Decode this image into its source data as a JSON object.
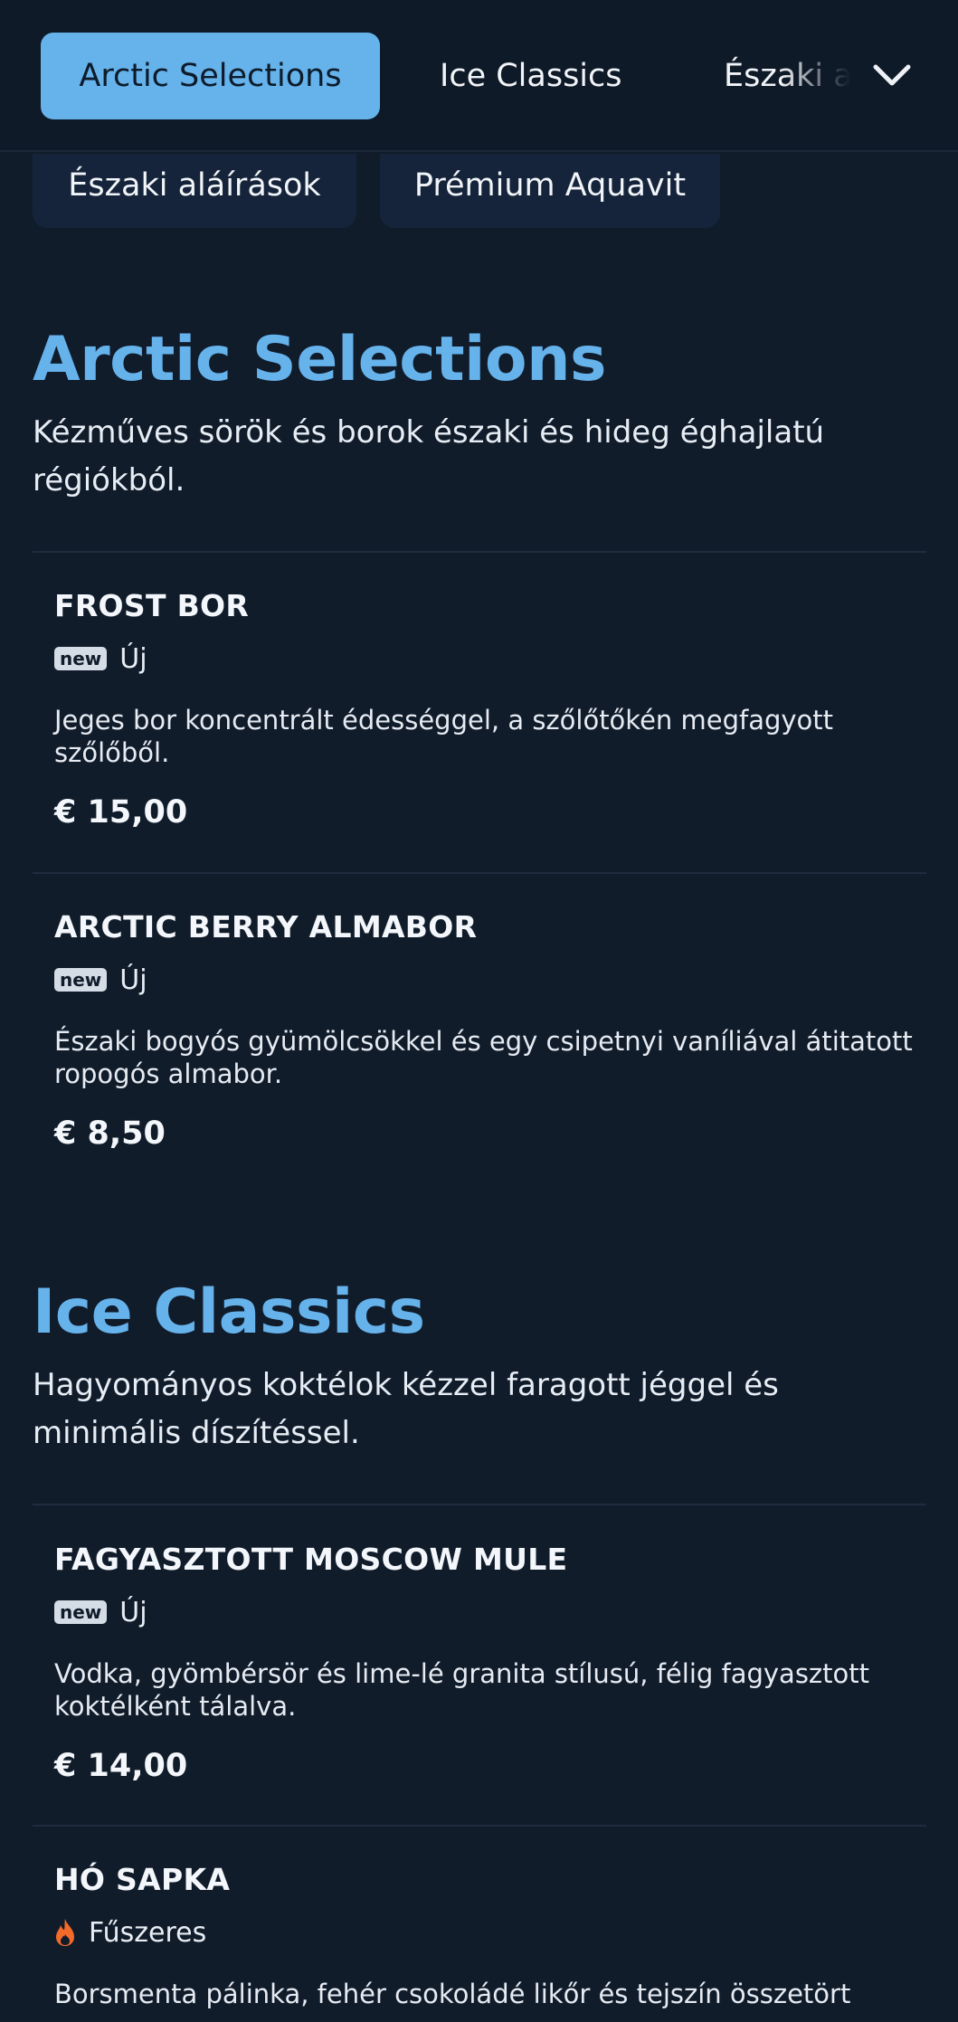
{
  "tabs": [
    {
      "label": "Arctic Selections",
      "active": true
    },
    {
      "label": "Ice Classics",
      "active": false
    },
    {
      "label": "Északi a",
      "active": false
    }
  ],
  "overflow_chips": [
    "Északi aláírások",
    "Prémium Aquavit"
  ],
  "icons": {
    "dropdown": "chevron-down-icon",
    "spicy": "flame-icon"
  },
  "colors": {
    "accent": "#66b2eb",
    "background": "#111c2b",
    "spicy": "#f26b2a"
  },
  "sections": [
    {
      "title": "Arctic Selections",
      "description": "Kézműves sörök és borok északi és hideg éghajlatú régiókból.",
      "items": [
        {
          "name": "FROST BOR",
          "badge": "new",
          "tag": "Új",
          "description": "Jeges bor koncentrált édességgel, a szőlőtőkén megfagyott szőlőből.",
          "price": "€ 15,00"
        },
        {
          "name": "ARCTIC BERRY ALMABOR",
          "badge": "new",
          "tag": "Új",
          "description": "Északi bogyós gyümölcsökkel és egy csipetnyi vaníliával átitatott ropogós almabor.",
          "price": "€ 8,50"
        }
      ]
    },
    {
      "title": "Ice Classics",
      "description": "Hagyományos koktélok kézzel faragott jéggel és minimális díszítéssel.",
      "items": [
        {
          "name": "FAGYASZTOTT MOSCOW MULE",
          "badge": "new",
          "tag": "Új",
          "description": "Vodka, gyömbérsör és lime-lé granita stílusú, félig fagyasztott koktélként tálalva.",
          "price": "€ 14,00"
        },
        {
          "name": "HÓ SAPKA",
          "tag": "Fűszeres",
          "description": "Borsmenta pálinka, fehér csokoládé likőr és tejszín összetört"
        }
      ]
    }
  ]
}
